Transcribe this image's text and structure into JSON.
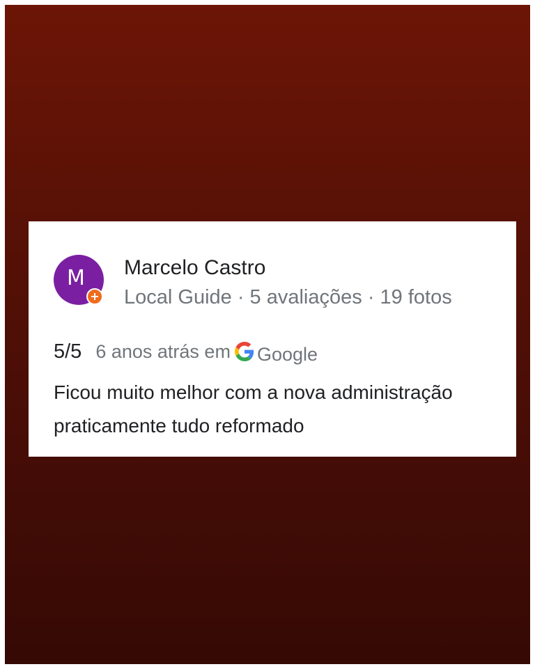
{
  "review": {
    "reviewer_initial": "M",
    "reviewer_name": "Marcelo Castro",
    "reviewer_meta": "Local Guide · 5 avaliações · 19 fotos",
    "rating": "5/5",
    "time": "6 anos atrás em",
    "source": "Google",
    "text": "Ficou muito melhor com a nova administração praticamente tudo reformado"
  },
  "icons": {
    "avatar_badge": "local-guide-badge-icon",
    "source_logo": "google-g-icon"
  },
  "colors": {
    "background_top": "#6c1506",
    "background_bottom": "#360905",
    "avatar": "#7b1fa2",
    "badge": "#ef6c1d",
    "secondary_text": "#70757a"
  }
}
